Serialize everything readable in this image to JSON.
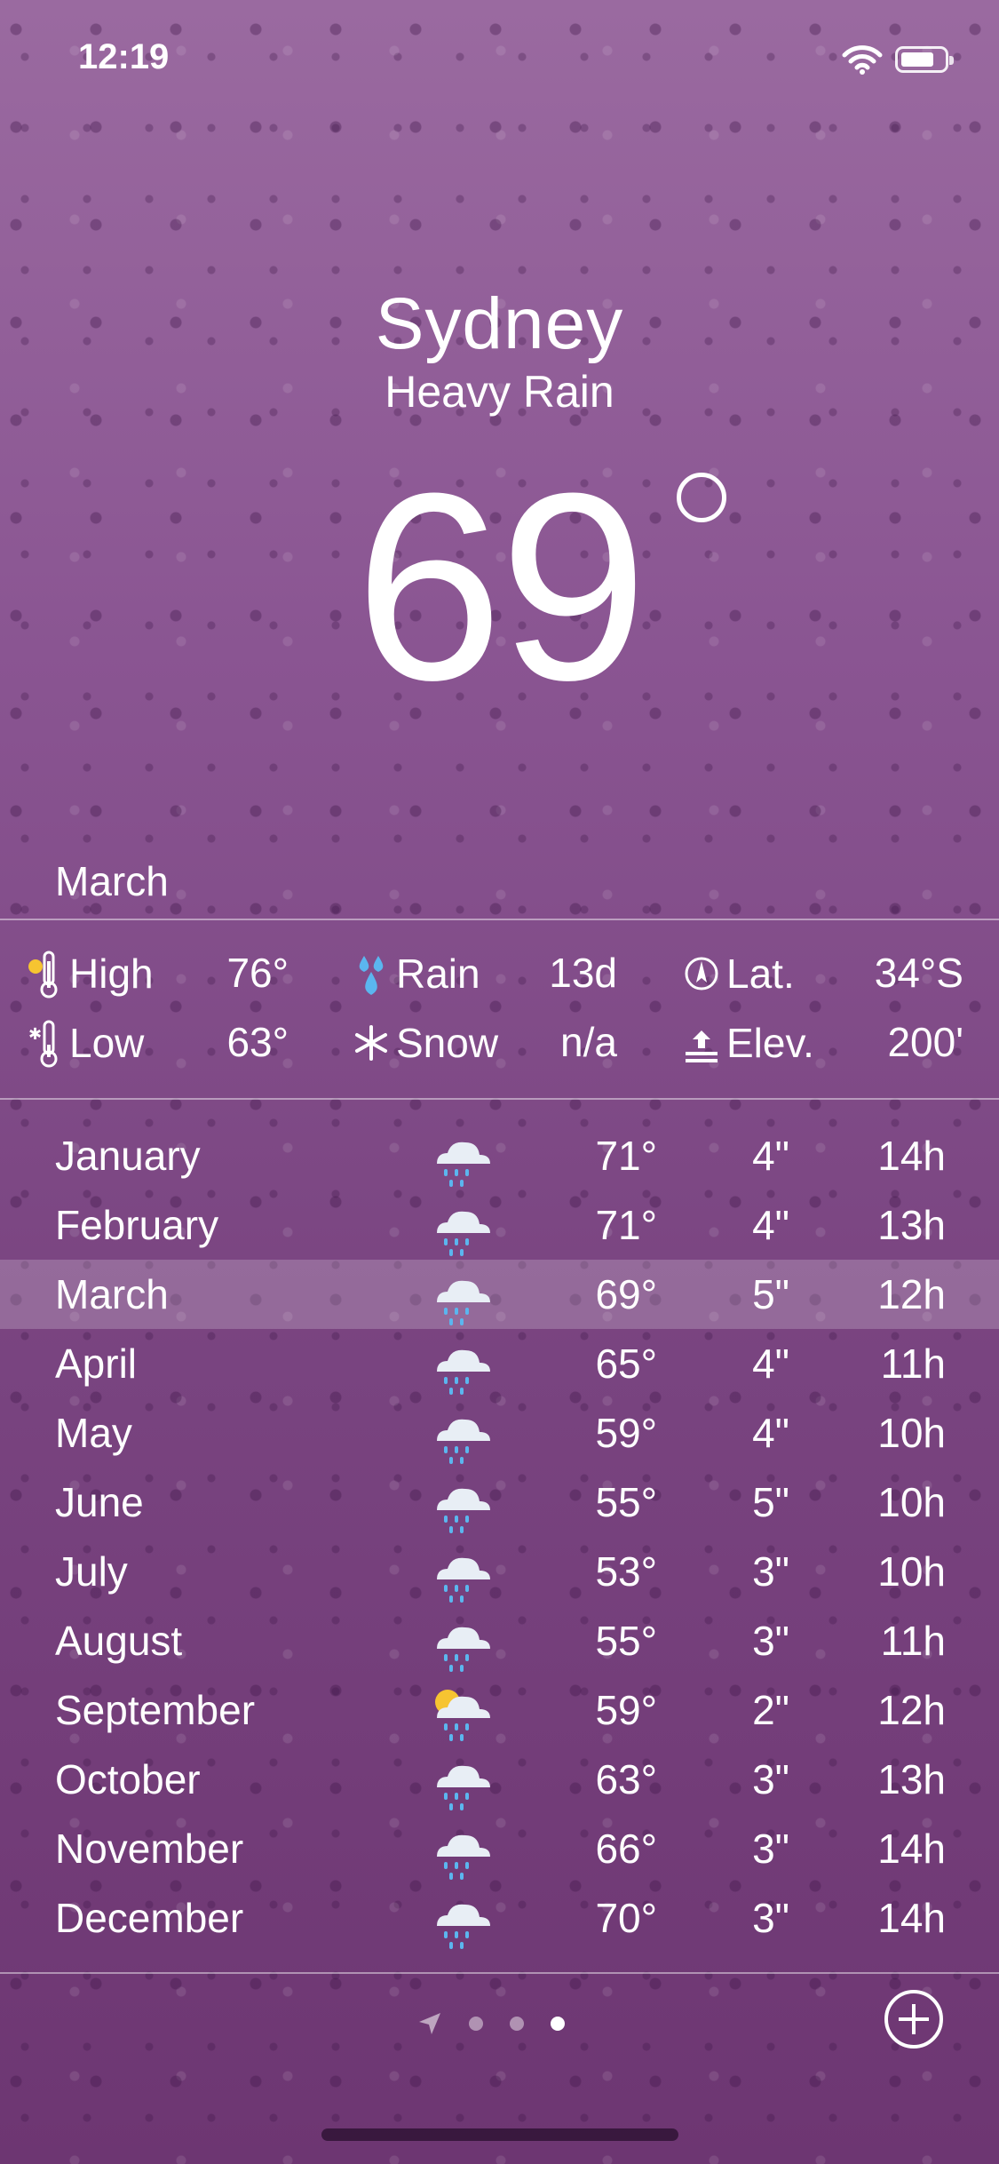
{
  "status": {
    "time": "12:19"
  },
  "header": {
    "city": "Sydney",
    "condition": "Heavy Rain",
    "temperature": "69"
  },
  "month_title": "March",
  "stats": {
    "high": {
      "label": "High",
      "value": "76°"
    },
    "low": {
      "label": "Low",
      "value": "63°"
    },
    "rain": {
      "label": "Rain",
      "value": "13d"
    },
    "snow": {
      "label": "Snow",
      "value": "n/a"
    },
    "lat": {
      "label": "Lat.",
      "value": "34°S"
    },
    "elev": {
      "label": "Elev.",
      "value": "200'"
    }
  },
  "months": [
    {
      "name": "January",
      "temp": "71°",
      "rain": "4\"",
      "daylight": "14h",
      "icon": "rain-cloud-icon"
    },
    {
      "name": "February",
      "temp": "71°",
      "rain": "4\"",
      "daylight": "13h",
      "icon": "rain-cloud-icon"
    },
    {
      "name": "March",
      "temp": "69°",
      "rain": "5\"",
      "daylight": "12h",
      "icon": "rain-cloud-icon",
      "selected": true
    },
    {
      "name": "April",
      "temp": "65°",
      "rain": "4\"",
      "daylight": "11h",
      "icon": "rain-cloud-icon"
    },
    {
      "name": "May",
      "temp": "59°",
      "rain": "4\"",
      "daylight": "10h",
      "icon": "rain-cloud-icon"
    },
    {
      "name": "June",
      "temp": "55°",
      "rain": "5\"",
      "daylight": "10h",
      "icon": "rain-cloud-icon"
    },
    {
      "name": "July",
      "temp": "53°",
      "rain": "3\"",
      "daylight": "10h",
      "icon": "rain-cloud-icon"
    },
    {
      "name": "August",
      "temp": "55°",
      "rain": "3\"",
      "daylight": "11h",
      "icon": "rain-cloud-icon"
    },
    {
      "name": "September",
      "temp": "59°",
      "rain": "2\"",
      "daylight": "12h",
      "icon": "sun-rain-cloud-icon"
    },
    {
      "name": "October",
      "temp": "63°",
      "rain": "3\"",
      "daylight": "13h",
      "icon": "rain-cloud-icon"
    },
    {
      "name": "November",
      "temp": "66°",
      "rain": "3\"",
      "daylight": "14h",
      "icon": "rain-cloud-icon"
    },
    {
      "name": "December",
      "temp": "70°",
      "rain": "3\"",
      "daylight": "14h",
      "icon": "rain-cloud-icon"
    }
  ],
  "pager": {
    "pages": 3,
    "active": 3
  },
  "colors": {
    "background": "#8a5592",
    "rain_drop": "#5bb6ef",
    "sun": "#f6c431"
  }
}
